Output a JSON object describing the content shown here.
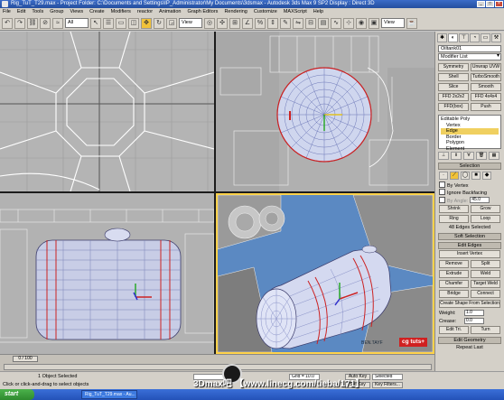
{
  "window": {
    "title": "Rig_TuT_T29.max    -    Project Folder: C:\\Documents and Settings\\IP_Administrator\\My Documents\\3dsmax    -    Autodesk 3ds Max 9 SP2           Display : Direct 3D"
  },
  "menu": [
    "File",
    "Edit",
    "Tools",
    "Group",
    "Views",
    "Create",
    "Modifiers",
    "reactor",
    "Animation",
    "Graph Editors",
    "Rendering",
    "Customize",
    "MAXScript",
    "Help"
  ],
  "toolbar": {
    "filter": "All",
    "ref_coord": "View",
    "named_set": "View"
  },
  "viewports": [
    {
      "id": "top",
      "label": ""
    },
    {
      "id": "front",
      "label": ""
    },
    {
      "id": "left",
      "label": ""
    },
    {
      "id": "perspective",
      "label": ""
    }
  ],
  "command_panel": {
    "object_name": "Oiltank01",
    "modifier_list": "Modifier List",
    "modifier_buttons": [
      "Symmetry",
      "Unwrap UVW",
      "Shell",
      "TurboSmooth",
      "Slice",
      "Smooth",
      "FFD 2x2x2",
      "FFD 4x4x4",
      "FFD(box)",
      "Push"
    ],
    "stack": [
      {
        "label": "Editable Poly",
        "level": 0
      },
      {
        "label": "Vertex",
        "level": 1
      },
      {
        "label": "Edge",
        "level": 1,
        "selected": true
      },
      {
        "label": "Border",
        "level": 1
      },
      {
        "label": "Polygon",
        "level": 1
      },
      {
        "label": "Element",
        "level": 1
      }
    ],
    "selection": {
      "title": "Selection",
      "by_vertex": "By Vertex",
      "ignore_backfacing": "Ignore Backfacing",
      "by_angle": "By Angle:",
      "by_angle_value": "45.0",
      "shrink": "Shrink",
      "grow": "Grow",
      "ring": "Ring",
      "loop": "Loop",
      "info": "48 Edges Selected"
    },
    "soft_selection": "Soft Selection",
    "edit_edges": {
      "title": "Edit Edges",
      "insert_vertex": "Insert Vertex",
      "buttons": [
        "Remove",
        "Split",
        "Extrude",
        "Weld",
        "Chamfer",
        "Target Weld",
        "Bridge",
        "Connect"
      ],
      "create_shape": "Create Shape From Selection",
      "weight_label": "Weight:",
      "weight_value": "1.0",
      "crease_label": "Crease:",
      "crease_value": "0.0",
      "edit_tri": "Edit Tri.",
      "turn": "Turn"
    },
    "edit_geometry": "Edit Geometry",
    "repeat_last": "Repeat Last"
  },
  "timeline": {
    "slider": "0 / 100"
  },
  "status": {
    "selection": "1 Object Selected",
    "prompt": "Click or click-and-drag to select objects",
    "grid": "Grid = 10.0",
    "auto_key": "Auto Key",
    "selected": "Selected",
    "set_key": "Set Key",
    "key_filters": "Key Filters..."
  },
  "taskbar": {
    "start": "start",
    "items": [
      "Rig_TuT_T29.max - Au..."
    ]
  },
  "overlay": {
    "cg_tuts": "cg tuts+",
    "persp_credit": "BEN.TAYF",
    "watermark": "3Dmax吧  【www.linecg.com/tieba/171】"
  },
  "colors": {
    "persp_bg": "#5b89c2",
    "active_border": "#ffd24a",
    "tank_wire": "#b9c7f2",
    "selected_edge": "#cc2222"
  }
}
